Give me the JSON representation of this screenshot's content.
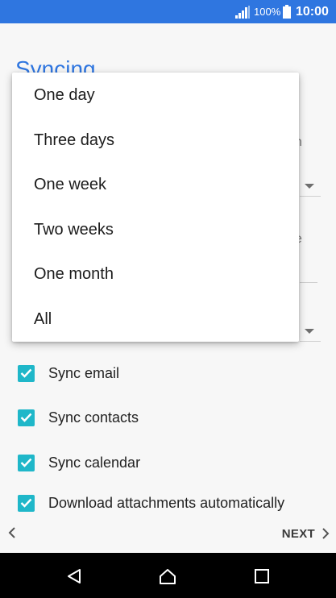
{
  "status_bar": {
    "battery_percent": "100%",
    "time": "10:00"
  },
  "page": {
    "title": "Syncing",
    "checkboxes": [
      {
        "label": "Sync email",
        "checked": true
      },
      {
        "label": "Sync contacts",
        "checked": true
      },
      {
        "label": "Sync calendar",
        "checked": true
      },
      {
        "label": "Download attachments automatically",
        "checked": true
      }
    ]
  },
  "popup_menu": {
    "options": [
      "One day",
      "Three days",
      "One week",
      "Two weeks",
      "One month",
      "All"
    ]
  },
  "bottom_nav": {
    "next_label": "NEXT"
  },
  "colors": {
    "status_bar": "#2f76e0",
    "title": "#2f76e0",
    "checkbox": "#1fb7c9"
  }
}
